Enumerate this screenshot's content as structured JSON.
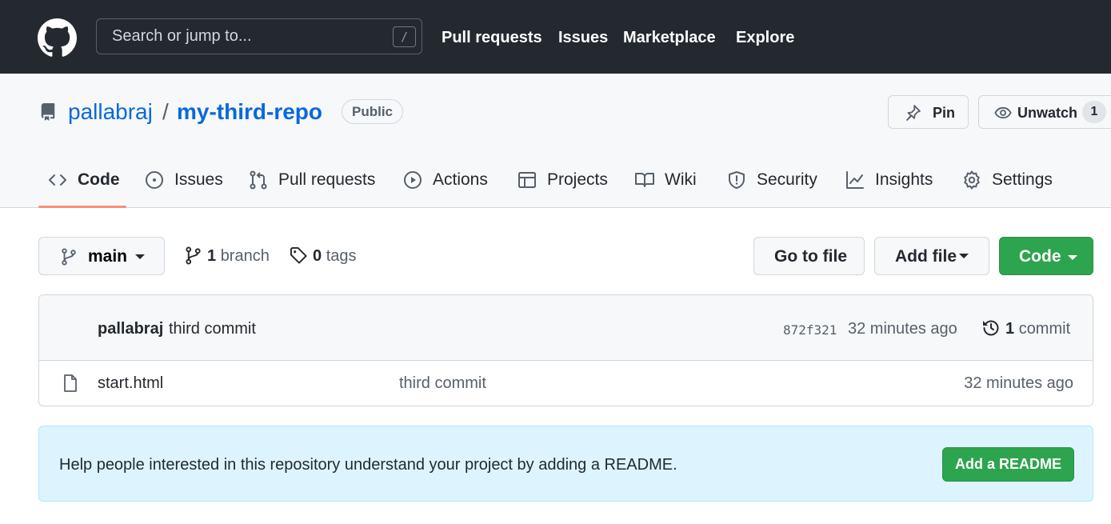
{
  "header": {
    "logo": "github-mark-icon",
    "search": {
      "placeholder": "Search or jump to...",
      "shortcut": "/"
    },
    "nav": [
      "Pull requests",
      "Issues",
      "Marketplace",
      "Explore"
    ]
  },
  "repo": {
    "icon": "repo-icon",
    "owner": "pallabraj",
    "separator": "/",
    "name": "my-third-repo",
    "visibility": "Public",
    "pin_label": "Pin",
    "watch_label": "Unwatch",
    "watch_count": "1",
    "tabs": [
      {
        "label": "Code",
        "icon": "code-icon",
        "active": true
      },
      {
        "label": "Issues",
        "icon": "issue-opened-icon"
      },
      {
        "label": "Pull requests",
        "icon": "git-pull-request-icon"
      },
      {
        "label": "Actions",
        "icon": "play-icon"
      },
      {
        "label": "Projects",
        "icon": "table-icon"
      },
      {
        "label": "Wiki",
        "icon": "book-icon"
      },
      {
        "label": "Security",
        "icon": "shield-icon"
      },
      {
        "label": "Insights",
        "icon": "graph-icon"
      },
      {
        "label": "Settings",
        "icon": "gear-icon"
      }
    ]
  },
  "filenav": {
    "branch": "main",
    "branch_count": "1",
    "branch_word": "branch",
    "tag_count": "0",
    "tag_word": "tags",
    "go_to_file": "Go to file",
    "add_file": "Add file",
    "code_button": "Code"
  },
  "latest_commit": {
    "author": "pallabraj",
    "message": "third commit",
    "sha": "872f321",
    "time": "32 minutes ago",
    "commit_count": "1",
    "commit_word": "commit"
  },
  "files": [
    {
      "name": "start.html",
      "icon": "file-icon",
      "commit_message": "third commit",
      "time": "32 minutes ago"
    }
  ],
  "readme_banner": {
    "text": "Help people interested in this repository understand your project by adding a README.",
    "button": "Add a README"
  },
  "colors": {
    "header_bg": "#24292f",
    "link": "#0969da",
    "primary_button": "#2da44e",
    "active_tab_underline": "#fd8c73",
    "banner_bg": "#ddf4ff"
  }
}
